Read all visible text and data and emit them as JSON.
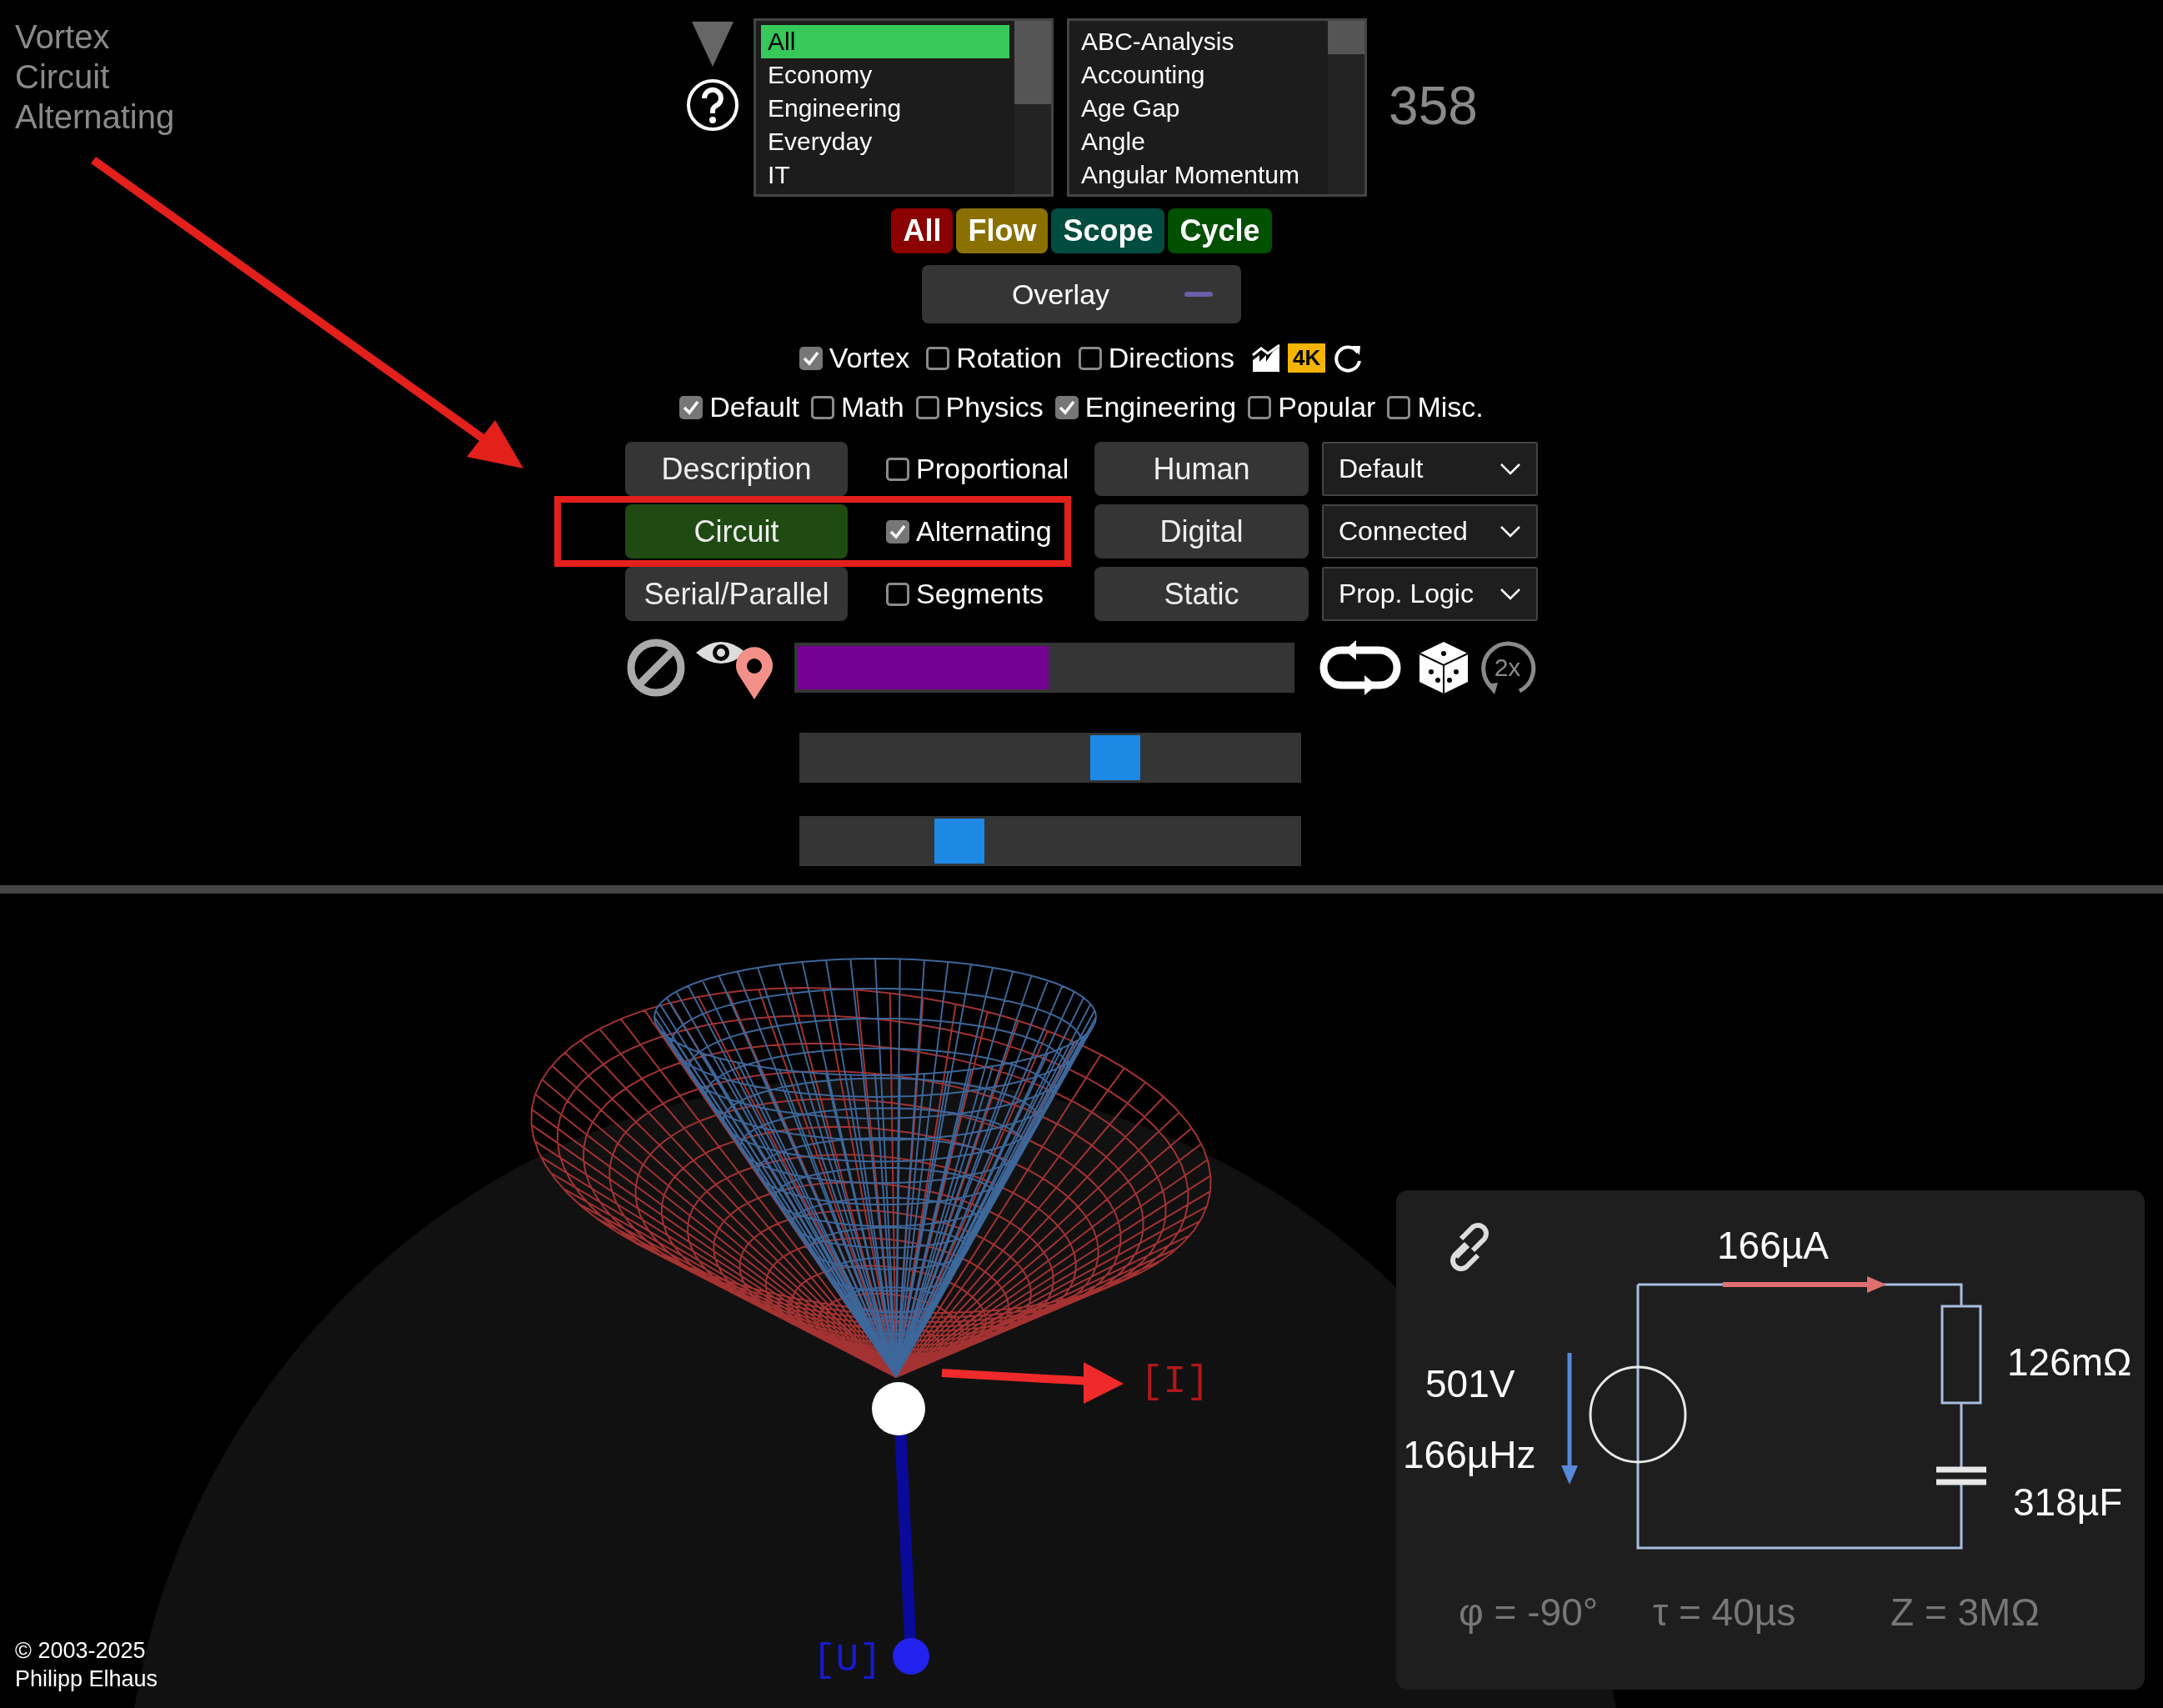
{
  "title_lines": [
    "Vortex",
    "Circuit",
    "Alternating"
  ],
  "category_list": {
    "items": [
      {
        "label": "All",
        "selected": true
      },
      {
        "label": "Economy",
        "selected": false
      },
      {
        "label": "Engineering",
        "selected": false
      },
      {
        "label": "Everyday",
        "selected": false
      },
      {
        "label": "IT",
        "selected": false
      }
    ]
  },
  "topic_list": {
    "items": [
      {
        "label": "ABC-Analysis",
        "selected": false
      },
      {
        "label": "Accounting",
        "selected": false
      },
      {
        "label": "Age Gap",
        "selected": false
      },
      {
        "label": "Angle",
        "selected": false
      },
      {
        "label": "Angular Momentum",
        "selected": false
      }
    ]
  },
  "count": "358",
  "mode_buttons": [
    {
      "label": "All",
      "color": "#8b0000"
    },
    {
      "label": "Flow",
      "color": "#8a7000"
    },
    {
      "label": "Scope",
      "color": "#004d40"
    },
    {
      "label": "Cycle",
      "color": "#005000"
    }
  ],
  "overlay_button": {
    "label": "Overlay"
  },
  "view_options": [
    {
      "label": "Vortex",
      "checked": true
    },
    {
      "label": "Rotation",
      "checked": false
    },
    {
      "label": "Directions",
      "checked": false
    }
  ],
  "quality_badge": "4K",
  "categories": [
    {
      "label": "Default",
      "checked": true
    },
    {
      "label": "Math",
      "checked": false
    },
    {
      "label": "Physics",
      "checked": false
    },
    {
      "label": "Engineering",
      "checked": true
    },
    {
      "label": "Popular",
      "checked": false
    },
    {
      "label": "Misc.",
      "checked": false
    }
  ],
  "grid_rows": [
    {
      "button": {
        "label": "Description",
        "selected": false
      },
      "option": {
        "label": "Proportional",
        "checked": false
      },
      "mode": {
        "label": "Human"
      },
      "select": {
        "value": "Default"
      }
    },
    {
      "button": {
        "label": "Circuit",
        "selected": true
      },
      "option": {
        "label": "Alternating",
        "checked": true
      },
      "mode": {
        "label": "Digital"
      },
      "select": {
        "value": "Connected"
      }
    },
    {
      "button": {
        "label": "Serial/Parallel",
        "selected": false
      },
      "option": {
        "label": "Segments",
        "checked": false
      },
      "mode": {
        "label": "Static"
      },
      "select": {
        "value": "Prop. Logic"
      }
    }
  ],
  "progress": {
    "level": 0.51
  },
  "speed_label": "2x",
  "sliders": [
    {
      "level": 0.63
    },
    {
      "level": 0.32
    }
  ],
  "scene": {
    "current_label": "[I]",
    "voltage_label": "[U]"
  },
  "circuit": {
    "current": "166µA",
    "voltage": "501V",
    "frequency": "166µHz",
    "resistance": "126mΩ",
    "capacitance": "318µF",
    "phase": "φ = -90°",
    "time_constant": "τ = 40µs",
    "impedance": "Z = 3MΩ"
  },
  "copyright": [
    "© 2003-2025",
    "Philipp Elhaus"
  ]
}
